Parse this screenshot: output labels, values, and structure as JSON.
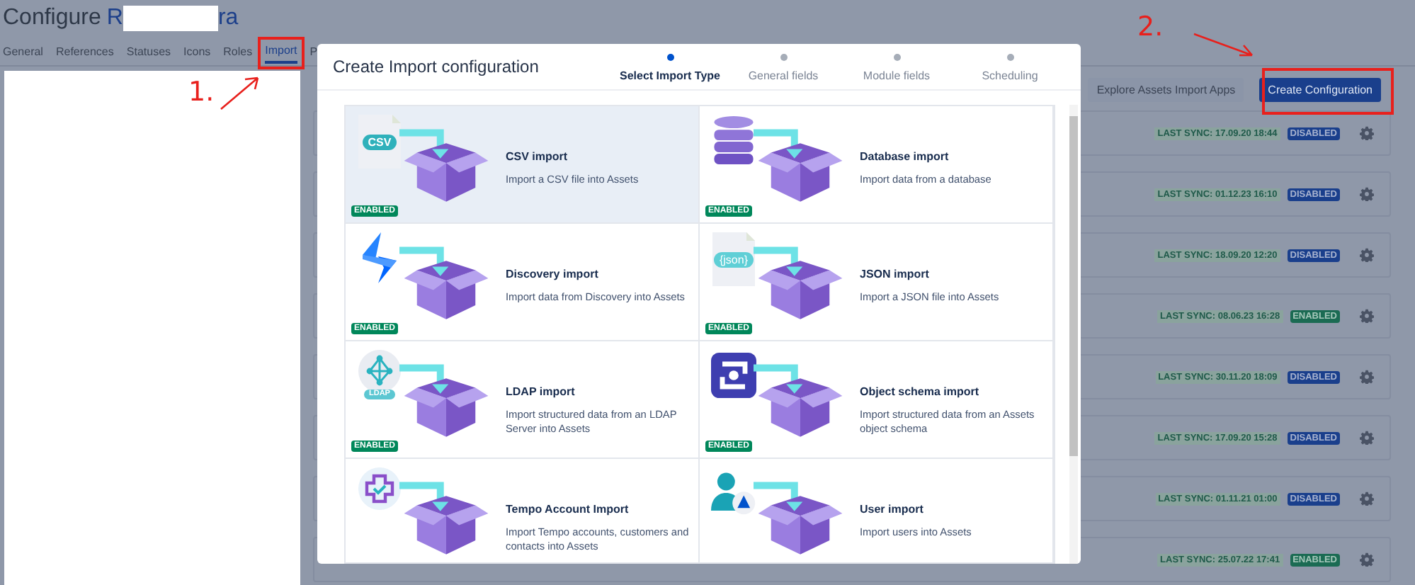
{
  "page": {
    "title": "Configure",
    "project_name_start": "R",
    "project_name_end": "ra"
  },
  "tabs": [
    {
      "label": "General",
      "selected": false
    },
    {
      "label": "References",
      "selected": false
    },
    {
      "label": "Statuses",
      "selected": false
    },
    {
      "label": "Icons",
      "selected": false
    },
    {
      "label": "Roles",
      "selected": false
    },
    {
      "label": "Import",
      "selected": true
    },
    {
      "label": "P",
      "selected": false
    }
  ],
  "toolbar": {
    "buttons": [
      "Explore Assets Import Apps",
      "Create Configuration"
    ]
  },
  "import_rows": [
    {
      "last_sync": "LAST SYNC: 17.09.20 18:44",
      "status": "DISABLED",
      "enabled": false
    },
    {
      "last_sync": "LAST SYNC: 01.12.23 16:10",
      "status": "DISABLED",
      "enabled": false
    },
    {
      "last_sync": "LAST SYNC: 18.09.20 12:20",
      "status": "DISABLED",
      "enabled": false
    },
    {
      "last_sync": "LAST SYNC: 08.06.23 16:28",
      "status": "ENABLED",
      "enabled": true
    },
    {
      "last_sync": "LAST SYNC: 30.11.20 18:09",
      "status": "DISABLED",
      "enabled": false
    },
    {
      "last_sync": "LAST SYNC: 17.09.20 15:28",
      "status": "DISABLED",
      "enabled": false
    },
    {
      "last_sync": "LAST SYNC: 01.11.21 01:00",
      "status": "DISABLED",
      "enabled": false
    },
    {
      "last_sync": "LAST SYNC: 25.07.22 17:41",
      "status": "ENABLED",
      "enabled": true
    }
  ],
  "modal": {
    "title": "Create Import configuration",
    "steps": [
      {
        "label": "Select Import Type",
        "selected": true
      },
      {
        "label": "General fields",
        "selected": false
      },
      {
        "label": "Module fields",
        "selected": false
      },
      {
        "label": "Scheduling",
        "selected": false
      }
    ],
    "import_types": [
      {
        "kind": "csv",
        "icon_text": "CSV",
        "title": "CSV import",
        "description": "Import a CSV file into Assets",
        "badge": "ENABLED",
        "selected": true
      },
      {
        "kind": "database",
        "title": "Database import",
        "description": "Import data from a database",
        "badge": "ENABLED",
        "selected": false
      },
      {
        "kind": "discovery",
        "title": "Discovery import",
        "description": "Import data from Discovery into Assets",
        "badge": "ENABLED",
        "selected": false
      },
      {
        "kind": "json",
        "icon_text": "{json}",
        "title": "JSON import",
        "description": "Import a JSON file into Assets",
        "badge": "ENABLED",
        "selected": false
      },
      {
        "kind": "ldap",
        "icon_text": "LDAP",
        "title": "LDAP import",
        "description": "Import structured data from an LDAP Server into Assets",
        "badge": "ENABLED",
        "selected": false
      },
      {
        "kind": "schema",
        "title": "Object schema import",
        "description": "Import structured data from an Assets object schema",
        "badge": "ENABLED",
        "selected": false
      },
      {
        "kind": "tempo",
        "title": "Tempo Account Import",
        "description": "Import Tempo accounts, customers and contacts into Assets",
        "selected": false
      },
      {
        "kind": "user",
        "title": "User import",
        "description": "Import users into Assets",
        "selected": false
      }
    ]
  },
  "annotations": [
    {
      "label": "1."
    },
    {
      "label": "2."
    }
  ]
}
